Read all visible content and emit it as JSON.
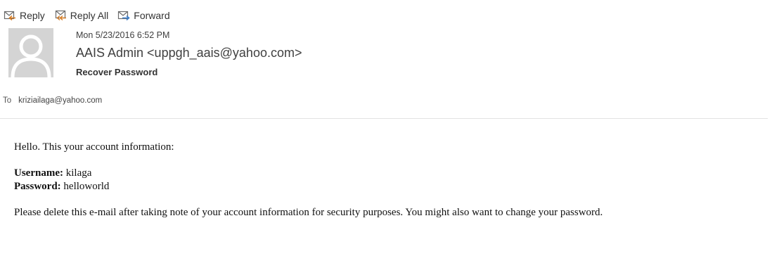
{
  "toolbar": {
    "reply_label": "Reply",
    "reply_all_label": "Reply All",
    "forward_label": "Forward"
  },
  "message": {
    "date": "Mon 5/23/2016 6:52 PM",
    "sender": "AAIS Admin <uppgh_aais@yahoo.com>",
    "subject": "Recover Password",
    "to_label": "To",
    "to": "kriziailaga@yahoo.com"
  },
  "body": {
    "greeting": "Hello. This your account information:",
    "username_label": "Username:",
    "username_value": "kilaga",
    "password_label": "Password:",
    "password_value": "helloworld",
    "note": "Please delete this e-mail after taking note of your account information for security purposes. You might also want to change your password."
  },
  "icons": {
    "reply": "reply-icon",
    "reply_all": "reply-all-icon",
    "forward": "forward-icon",
    "avatar": "avatar-placeholder-icon"
  },
  "colors": {
    "avatar_bg": "#d4d4d4",
    "avatar_fg": "#ffffff",
    "icon_stroke": "#6b6b6b",
    "icon_accent": "#d67a1f"
  }
}
